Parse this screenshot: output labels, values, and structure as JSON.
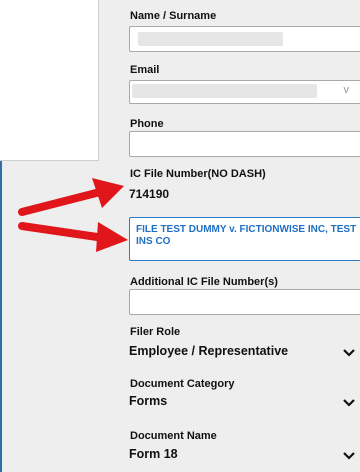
{
  "form": {
    "name_label": "Name / Surname",
    "email_label": "Email",
    "email_partial": "v",
    "phone_label": "Phone",
    "ic_file_label": "IC File Number(NO DASH)",
    "ic_file_value": "714190",
    "case_title": "FILE TEST DUMMY v. FICTIONWISE INC, TEST INS CO",
    "additional_ic_label": "Additional IC File Number(s)",
    "filer_role_label": "Filer Role",
    "filer_role_value": "Employee / Representative",
    "doc_category_label": "Document Category",
    "doc_category_value": "Forms",
    "doc_name_label": "Document Name",
    "doc_name_value": "Form 18"
  },
  "colors": {
    "accent": "#1f6fc4",
    "arrow": "#e0161a"
  },
  "icons": [
    "chevron-down-icon",
    "red-arrow-icon"
  ]
}
